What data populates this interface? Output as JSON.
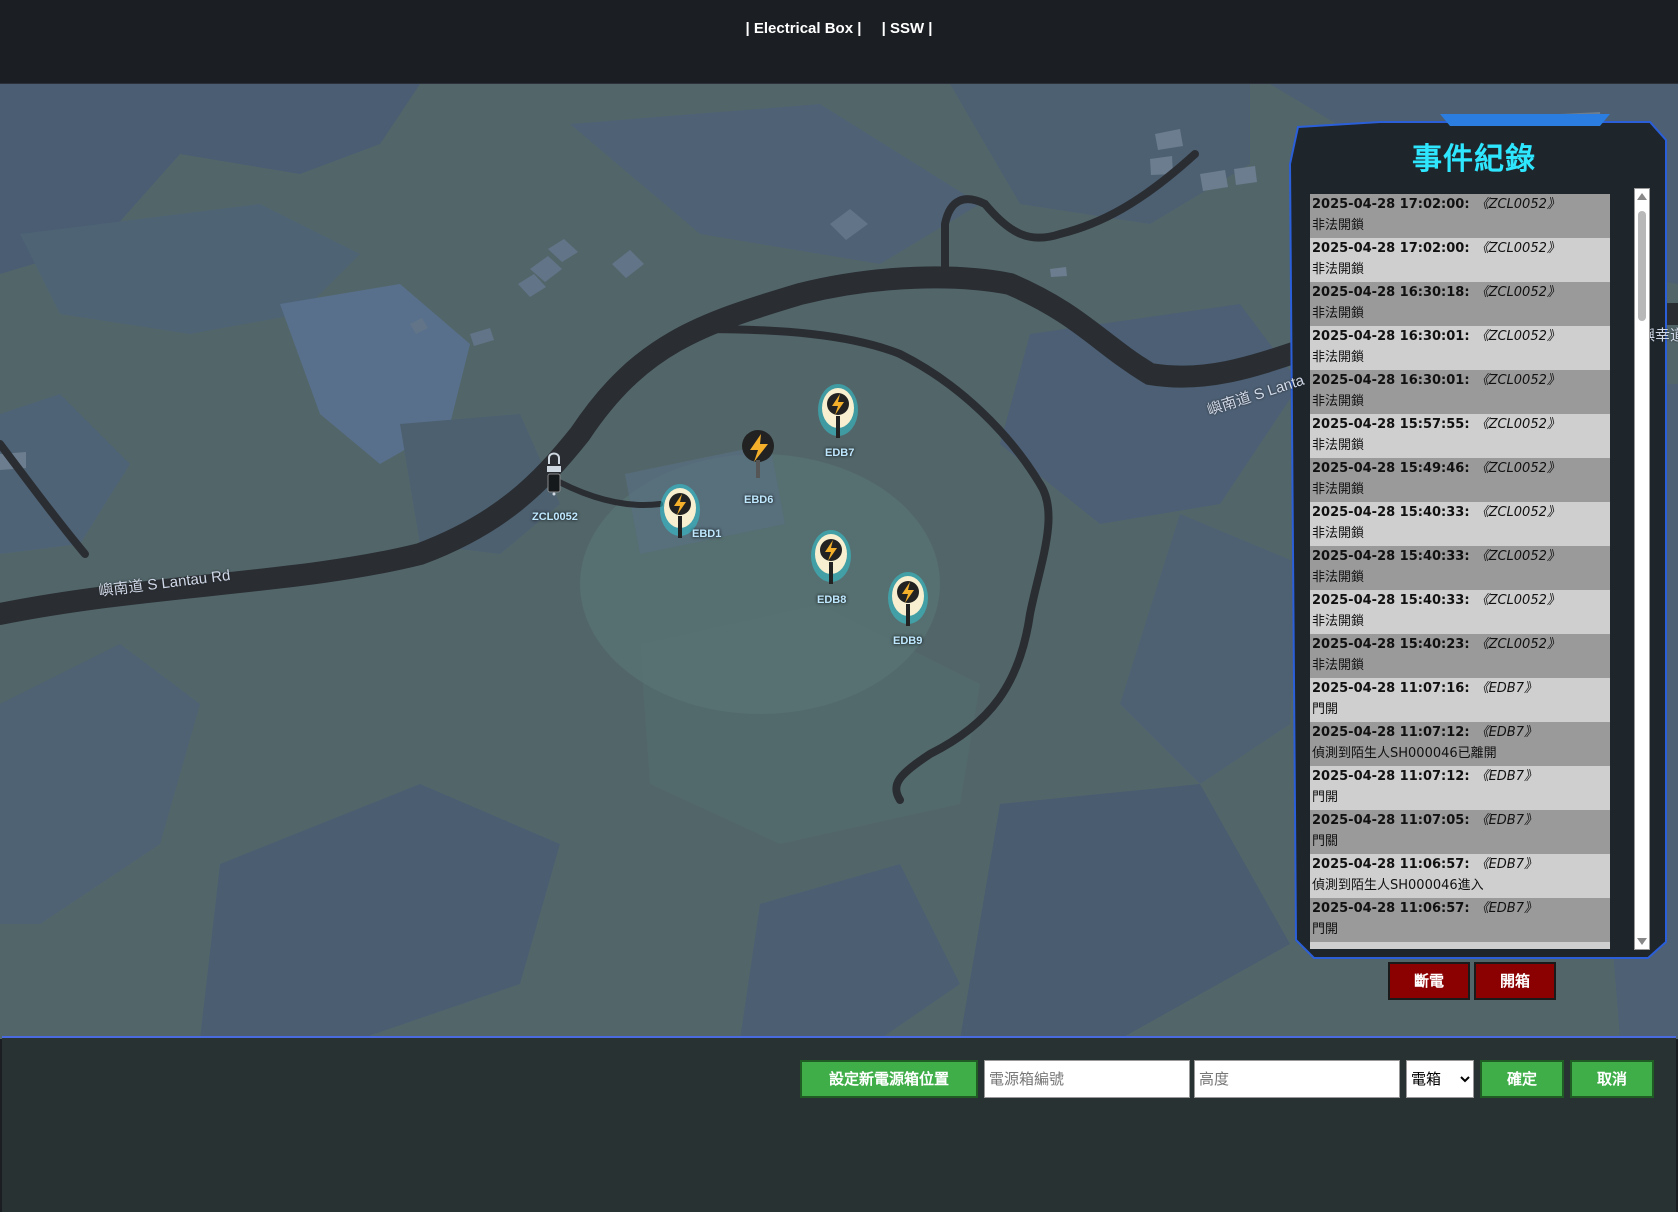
{
  "nav": {
    "electrical_box": "| Electrical Box |",
    "ssw": "| SSW |"
  },
  "map": {
    "road_labels": [
      "嶼南道 S Lantau Rd",
      "嶼南道 S Lanta",
      "嶼幸道"
    ],
    "lock": {
      "label": "ZCL0052"
    },
    "boxes": [
      {
        "id": "EBD1",
        "label": "EBD1"
      },
      {
        "id": "EBD6",
        "label": "EBD6"
      },
      {
        "id": "EDB7",
        "label": "EDB7"
      },
      {
        "id": "EDB8",
        "label": "EDB8"
      },
      {
        "id": "EDB9",
        "label": "EDB9"
      }
    ]
  },
  "events_panel": {
    "title": "事件紀錄",
    "items": [
      {
        "time": "2025-04-28 17:02:00:",
        "device": "《ZCL0052》",
        "message": "非法開鎖"
      },
      {
        "time": "2025-04-28 17:02:00:",
        "device": "《ZCL0052》",
        "message": "非法開鎖"
      },
      {
        "time": "2025-04-28 16:30:18:",
        "device": "《ZCL0052》",
        "message": "非法開鎖"
      },
      {
        "time": "2025-04-28 16:30:01:",
        "device": "《ZCL0052》",
        "message": "非法開鎖"
      },
      {
        "time": "2025-04-28 16:30:01:",
        "device": "《ZCL0052》",
        "message": "非法開鎖"
      },
      {
        "time": "2025-04-28 15:57:55:",
        "device": "《ZCL0052》",
        "message": "非法開鎖"
      },
      {
        "time": "2025-04-28 15:49:46:",
        "device": "《ZCL0052》",
        "message": "非法開鎖"
      },
      {
        "time": "2025-04-28 15:40:33:",
        "device": "《ZCL0052》",
        "message": "非法開鎖"
      },
      {
        "time": "2025-04-28 15:40:33:",
        "device": "《ZCL0052》",
        "message": "非法開鎖"
      },
      {
        "time": "2025-04-28 15:40:33:",
        "device": "《ZCL0052》",
        "message": "非法開鎖"
      },
      {
        "time": "2025-04-28 15:40:23:",
        "device": "《ZCL0052》",
        "message": "非法開鎖"
      },
      {
        "time": "2025-04-28 11:07:16:",
        "device": "《EDB7》",
        "message": "門開"
      },
      {
        "time": "2025-04-28 11:07:12:",
        "device": "《EDB7》",
        "message": "偵測到陌生人SH000046已離開"
      },
      {
        "time": "2025-04-28 11:07:12:",
        "device": "《EDB7》",
        "message": "門開"
      },
      {
        "time": "2025-04-28 11:07:05:",
        "device": "《EDB7》",
        "message": "門關"
      },
      {
        "time": "2025-04-28 11:06:57:",
        "device": "《EDB7》",
        "message": "偵測到陌生人SH000046進入"
      },
      {
        "time": "2025-04-28 11:06:57:",
        "device": "《EDB7》",
        "message": "門開"
      }
    ],
    "power_off_label": "斷電",
    "open_box_label": "開箱"
  },
  "form": {
    "set_location_label": "設定新電源箱位置",
    "box_number_placeholder": "電源箱編號",
    "height_placeholder": "高度",
    "type_selected": "電箱",
    "confirm_label": "確定",
    "cancel_label": "取消"
  },
  "colors": {
    "title_cyan": "#2fe6ff",
    "danger_red": "#8b0000",
    "ok_green": "#3fae49",
    "panel_border": "#2b5fd9"
  }
}
